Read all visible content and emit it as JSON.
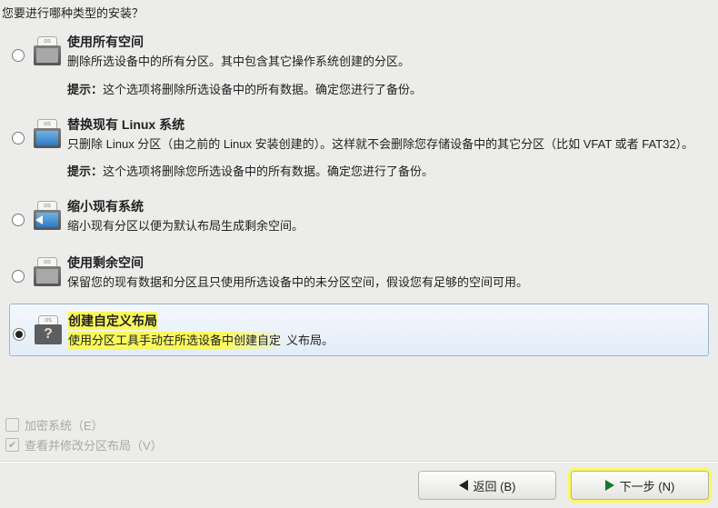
{
  "question": "您要进行哪种类型的安装？",
  "options": [
    {
      "id": "use-all-space",
      "title": "使用所有空间",
      "desc": "删除所选设备中的所有分区。其中包含其它操作系统创建的分区。",
      "warn_label": "提示：",
      "warn": "这个选项将删除所选设备中的所有数据。确定您进行了备份。"
    },
    {
      "id": "replace-linux",
      "title": "替换现有 Linux 系统",
      "desc": "只删除 Linux 分区（由之前的 Linux 安装创建的）。这样就不会删除您存储设备中的其它分区（比如 VFAT 或者 FAT32）。",
      "warn_label": "提示：",
      "warn": "这个选项将删除您所选设备中的所有数据。确定您进行了备份。"
    },
    {
      "id": "shrink-system",
      "title": "缩小现有系统",
      "desc": "缩小现有分区以便为默认布局生成剩余空间。"
    },
    {
      "id": "use-free-space",
      "title": "使用剩余空间",
      "desc": "保留您的现有数据和分区且只使用所选设备中的未分区空间，假设您有足够的空间可用。"
    },
    {
      "id": "custom-layout",
      "title": "创建自定义布局",
      "desc_a": "使用分区工具手动在所选设备中创建自定",
      "desc_b": "义布局。"
    }
  ],
  "selected": "custom-layout",
  "checks": {
    "encrypt": "加密系统（E）",
    "review": "查看并修改分区布局（V）"
  },
  "buttons": {
    "back": "返回 (B)",
    "next": "下一步 (N)"
  },
  "os_tag": "os"
}
